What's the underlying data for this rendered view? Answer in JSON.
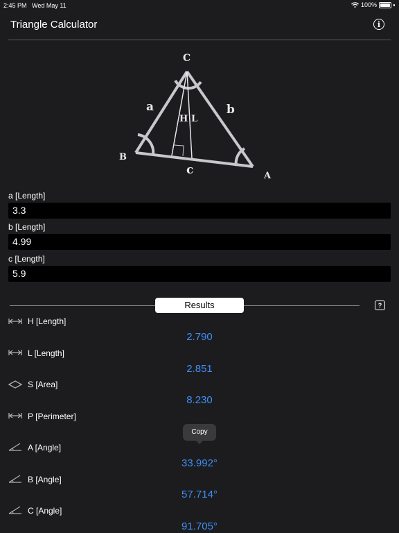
{
  "status_bar": {
    "time": "2:45 PM",
    "date": "Wed May 11",
    "battery": "100%"
  },
  "nav": {
    "title": "Triangle Calculator",
    "info_icon": "i"
  },
  "diagram": {
    "vertex_labels": {
      "A": "A",
      "B": "B",
      "C": "C"
    },
    "side_labels": {
      "a": "a",
      "b": "b",
      "c": "c"
    },
    "height_label": "H",
    "bisector_label": "L"
  },
  "inputs": [
    {
      "label": "a [Length]",
      "value": "3.3"
    },
    {
      "label": "b [Length]",
      "value": "4.99"
    },
    {
      "label": "c [Length]",
      "value": "5.9"
    }
  ],
  "results_header": {
    "label": "Results",
    "help_icon": "?"
  },
  "results": [
    {
      "icon": "length-icon",
      "label": "H [Length]",
      "value": "2.790"
    },
    {
      "icon": "length-icon",
      "label": "L [Length]",
      "value": "2.851"
    },
    {
      "icon": "area-icon",
      "label": "S [Area]",
      "value": "8.230"
    },
    {
      "icon": "length-icon",
      "label": "P [Perimeter]",
      "value": ""
    },
    {
      "icon": "angle-icon",
      "label": "A [Angle]",
      "value": "33.992°"
    },
    {
      "icon": "angle-icon",
      "label": "B [Angle]",
      "value": "57.714°"
    },
    {
      "icon": "angle-icon",
      "label": "C [Angle]",
      "value": "91.705°"
    }
  ],
  "tooltip": {
    "label": "Copy"
  },
  "colors": {
    "background": "#1c1c1e",
    "accent": "#3f8ef5",
    "input_bg": "#000000"
  }
}
